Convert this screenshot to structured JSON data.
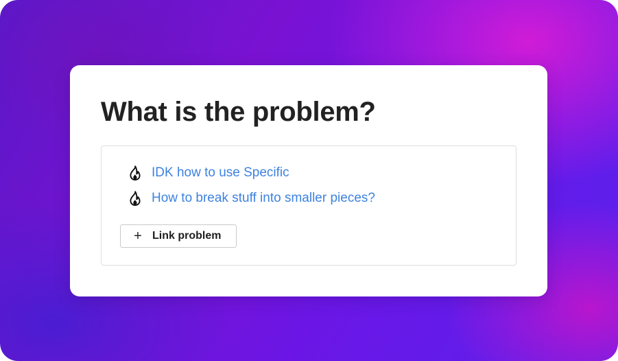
{
  "card": {
    "title": "What is the problem?",
    "problems": [
      {
        "icon": "fire-icon",
        "label": "IDK how to use Specific"
      },
      {
        "icon": "fire-icon",
        "label": "How to break stuff into smaller pieces?"
      }
    ],
    "link_button": {
      "icon": "plus-icon",
      "plus_glyph": "+",
      "label": "Link problem"
    }
  },
  "colors": {
    "link": "#3d82e0",
    "title": "#222222",
    "background_purple": "#7a12d2",
    "background_magenta": "#d61cd6",
    "background_blue": "#5a22ee"
  }
}
